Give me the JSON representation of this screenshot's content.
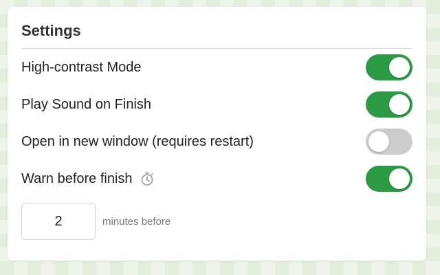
{
  "settings": {
    "title": "Settings",
    "options": [
      {
        "label": "High-contrast Mode",
        "enabled": true
      },
      {
        "label": "Play Sound on Finish",
        "enabled": true
      },
      {
        "label": "Open in new window (requires restart)",
        "enabled": false
      },
      {
        "label": "Warn before finish",
        "enabled": true,
        "icon": "stopwatch-icon"
      }
    ],
    "warn_minutes": {
      "value": "2",
      "suffix": "minutes before"
    }
  },
  "colors": {
    "toggle_on": "#2c9a45",
    "toggle_off": "#cccccc"
  }
}
